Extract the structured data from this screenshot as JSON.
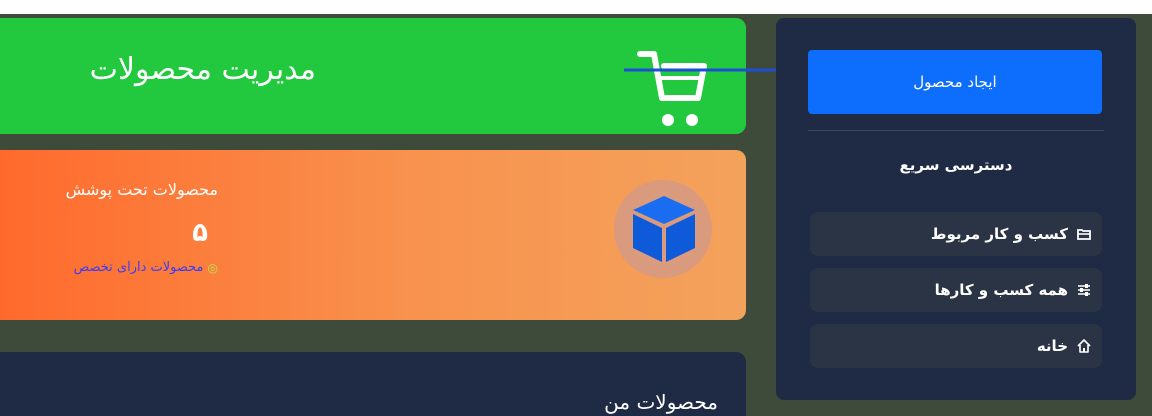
{
  "header": {
    "title": "مدیریت محصولات"
  },
  "stats": {
    "label": "محصولات تحت پوشش",
    "value": "۵",
    "link_text": "محصولات دارای تخصص"
  },
  "sidebar": {
    "create_button": "ایجاد محصول",
    "quick_access_title": "دسترسی سریع",
    "items": [
      {
        "label": "کسب و کار مربوط",
        "icon": "folder-icon"
      },
      {
        "label": "همه کسب و کارها",
        "icon": "sliders-icon"
      },
      {
        "label": "خانه",
        "icon": "home-icon"
      }
    ]
  },
  "products": {
    "title": "محصولات من"
  },
  "colors": {
    "green": "#22c93f",
    "orange": "#ff6a2c",
    "blue": "#0d6efd",
    "panel": "#1f2a44"
  }
}
